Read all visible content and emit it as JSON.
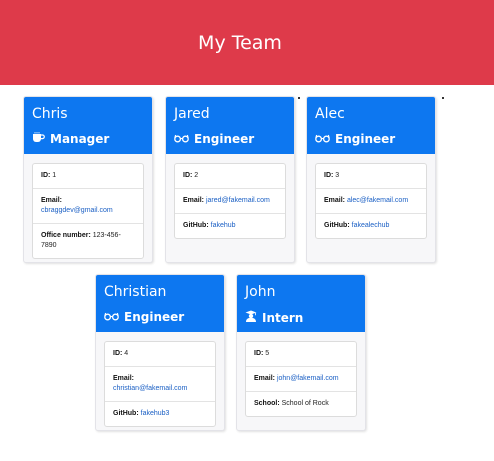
{
  "header": {
    "title": "My Team"
  },
  "cards": [
    {
      "name": "Chris",
      "role": "Manager",
      "role_icon": "coffee-mug-icon",
      "id_label": "ID:",
      "id": "1",
      "email_label": "Email:",
      "email": "cbraggdev@gmail.com",
      "extra_label": "Office number:",
      "extra": "123-456-7890"
    },
    {
      "name": "Jared",
      "role": "Engineer",
      "role_icon": "glasses-icon",
      "id_label": "ID:",
      "id": "2",
      "email_label": "Email:",
      "email": "jared@fakemail.com",
      "extra_label": "GitHub:",
      "extra": "fakehub"
    },
    {
      "name": "Alec",
      "role": "Engineer",
      "role_icon": "glasses-icon",
      "id_label": "ID:",
      "id": "3",
      "email_label": "Email:",
      "email": "alec@fakemail.com",
      "extra_label": "GitHub:",
      "extra": "fakealechub"
    },
    {
      "name": "Christian",
      "role": "Engineer",
      "role_icon": "glasses-icon",
      "id_label": "ID:",
      "id": "4",
      "email_label": "Email:",
      "email": "christian@fakemail.com",
      "extra_label": "GitHub:",
      "extra": "fakehub3"
    },
    {
      "name": "John",
      "role": "Intern",
      "role_icon": "graduate-icon",
      "id_label": "ID:",
      "id": "5",
      "email_label": "Email:",
      "email": "john@fakemail.com",
      "extra_label": "School:",
      "extra": "School of Rock"
    }
  ],
  "colors": {
    "header_bg": "#de3a4a",
    "card_head_bg": "#0d77f0",
    "link": "#1a5fc4"
  }
}
